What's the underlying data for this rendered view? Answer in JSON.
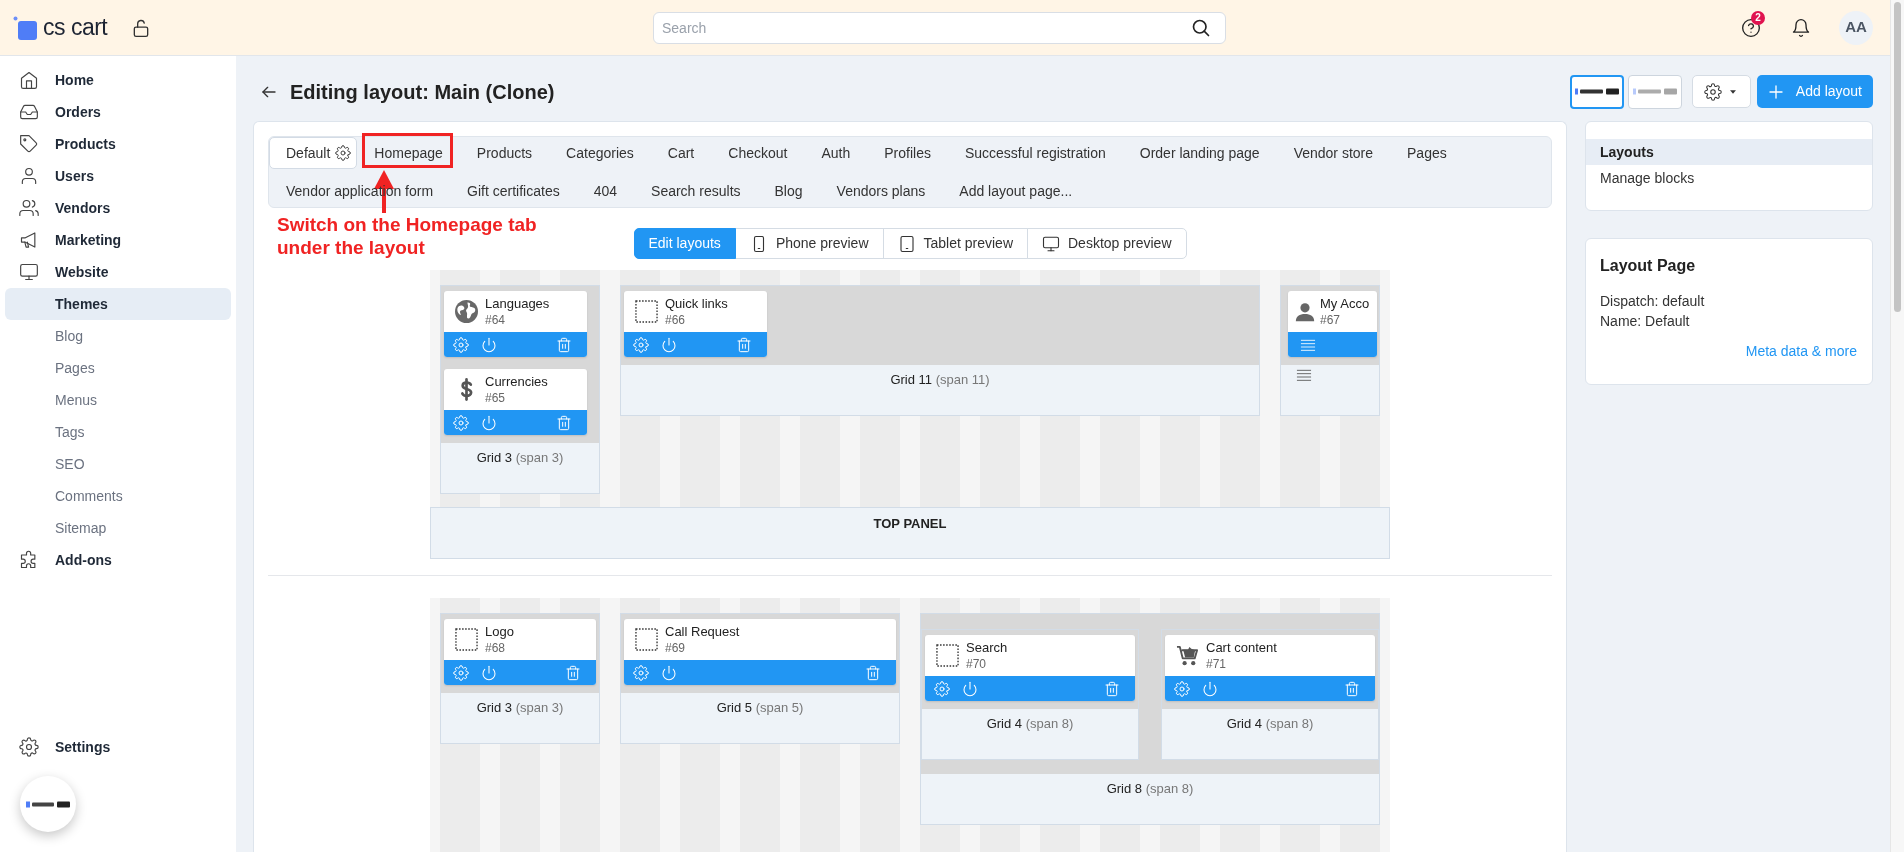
{
  "header": {
    "logo": "cs cart",
    "search": {
      "placeholder": "Search"
    },
    "help_badge": "2",
    "avatar": "AA"
  },
  "sidebar": {
    "items": [
      {
        "label": "Home",
        "selected": false
      },
      {
        "label": "Orders",
        "selected": false
      },
      {
        "label": "Products",
        "selected": false
      },
      {
        "label": "Users",
        "selected": false
      },
      {
        "label": "Vendors",
        "selected": false
      },
      {
        "label": "Marketing",
        "selected": false
      },
      {
        "label": "Website",
        "selected": false,
        "expanded": true,
        "children": [
          {
            "label": "Themes",
            "selected": true
          },
          {
            "label": "Blog",
            "selected": false
          },
          {
            "label": "Pages",
            "selected": false
          },
          {
            "label": "Menus",
            "selected": false
          },
          {
            "label": "Tags",
            "selected": false
          },
          {
            "label": "SEO",
            "selected": false
          },
          {
            "label": "Comments",
            "selected": false
          },
          {
            "label": "Sitemap",
            "selected": false
          }
        ]
      },
      {
        "label": "Add-ons",
        "selected": false
      }
    ],
    "bottom_items": [
      {
        "label": "Settings",
        "selected": false
      }
    ]
  },
  "page": {
    "title": "Editing layout: Main (Clone)",
    "style_thumbnails": [
      {
        "selected": true
      },
      {
        "selected": false
      }
    ],
    "add_button": "Add layout"
  },
  "tabs": [
    {
      "label": "Default",
      "selected": true
    },
    {
      "label": "Homepage",
      "selected": false
    },
    {
      "label": "Products",
      "selected": false
    },
    {
      "label": "Categories",
      "selected": false
    },
    {
      "label": "Cart",
      "selected": false
    },
    {
      "label": "Checkout",
      "selected": false
    },
    {
      "label": "Auth",
      "selected": false
    },
    {
      "label": "Profiles",
      "selected": false
    },
    {
      "label": "Successful registration",
      "selected": false
    },
    {
      "label": "Order landing page",
      "selected": false
    },
    {
      "label": "Vendor store",
      "selected": false
    },
    {
      "label": "Pages",
      "selected": false
    },
    {
      "label": "Vendor application form",
      "selected": false
    },
    {
      "label": "Gift certificates",
      "selected": false
    },
    {
      "label": "404",
      "selected": false
    },
    {
      "label": "Search results",
      "selected": false
    },
    {
      "label": "Blog",
      "selected": false
    },
    {
      "label": "Vendors plans",
      "selected": false
    },
    {
      "label": "Add layout page...",
      "selected": false
    }
  ],
  "annotation": {
    "text": "Switch on the Homepage tab under the layout"
  },
  "view_modes": [
    {
      "kind": "edit",
      "label": "Edit layouts",
      "selected": true
    },
    {
      "kind": "phone",
      "label": "Phone preview",
      "selected": false
    },
    {
      "kind": "tablet",
      "label": "Tablet preview",
      "selected": false
    },
    {
      "kind": "desktop",
      "label": "Desktop preview",
      "selected": false
    }
  ],
  "sections": [
    {
      "label": "TOP PANEL",
      "grids": [
        {
          "label": "Grid 3",
          "span": "(span 3)",
          "compact": false,
          "blocks": [
            {
              "kind": "languages",
              "title": "Languages",
              "number": "#64"
            },
            {
              "kind": "currencies",
              "title": "Currencies",
              "number": "#65"
            }
          ]
        },
        {
          "label": "Grid 11",
          "span": "(span 11)",
          "compact": false,
          "blocks": [
            {
              "kind": "generic",
              "title": "Quick links",
              "number": "#66"
            }
          ]
        },
        {
          "compact": true,
          "blocks": [
            {
              "kind": "account",
              "title": "My Acco",
              "number": "#67"
            }
          ]
        }
      ]
    },
    {
      "grids": [
        {
          "label": "Grid 3",
          "span": "(span 3)",
          "compact": false,
          "blocks": [
            {
              "kind": "generic",
              "title": "Logo",
              "number": "#68"
            }
          ]
        },
        {
          "label": "Grid 5",
          "span": "(span 5)",
          "compact": false,
          "blocks": [
            {
              "kind": "generic",
              "title": "Call Request",
              "number": "#69"
            }
          ]
        },
        {
          "label": "Grid 8",
          "span": "(span 8)",
          "compact": false,
          "children": [
            {
              "label": "Grid 4",
              "span": "(span 8)",
              "compact": false,
              "blocks": [
                {
                  "kind": "generic",
                  "title": "Search",
                  "number": "#70"
                }
              ]
            },
            {
              "label": "Grid 4",
              "span": "(span 8)",
              "compact": false,
              "blocks": [
                {
                  "kind": "cart",
                  "title": "Cart content",
                  "number": "#71"
                }
              ]
            }
          ]
        }
      ]
    }
  ],
  "side_menu": {
    "items": [
      {
        "label": "Layouts",
        "selected": true
      },
      {
        "label": "Manage blocks",
        "selected": false
      }
    ]
  },
  "layout_page": {
    "title": "Layout Page",
    "lines": [
      "Dispatch: default",
      "Name: Default"
    ],
    "link": "Meta data & more"
  }
}
